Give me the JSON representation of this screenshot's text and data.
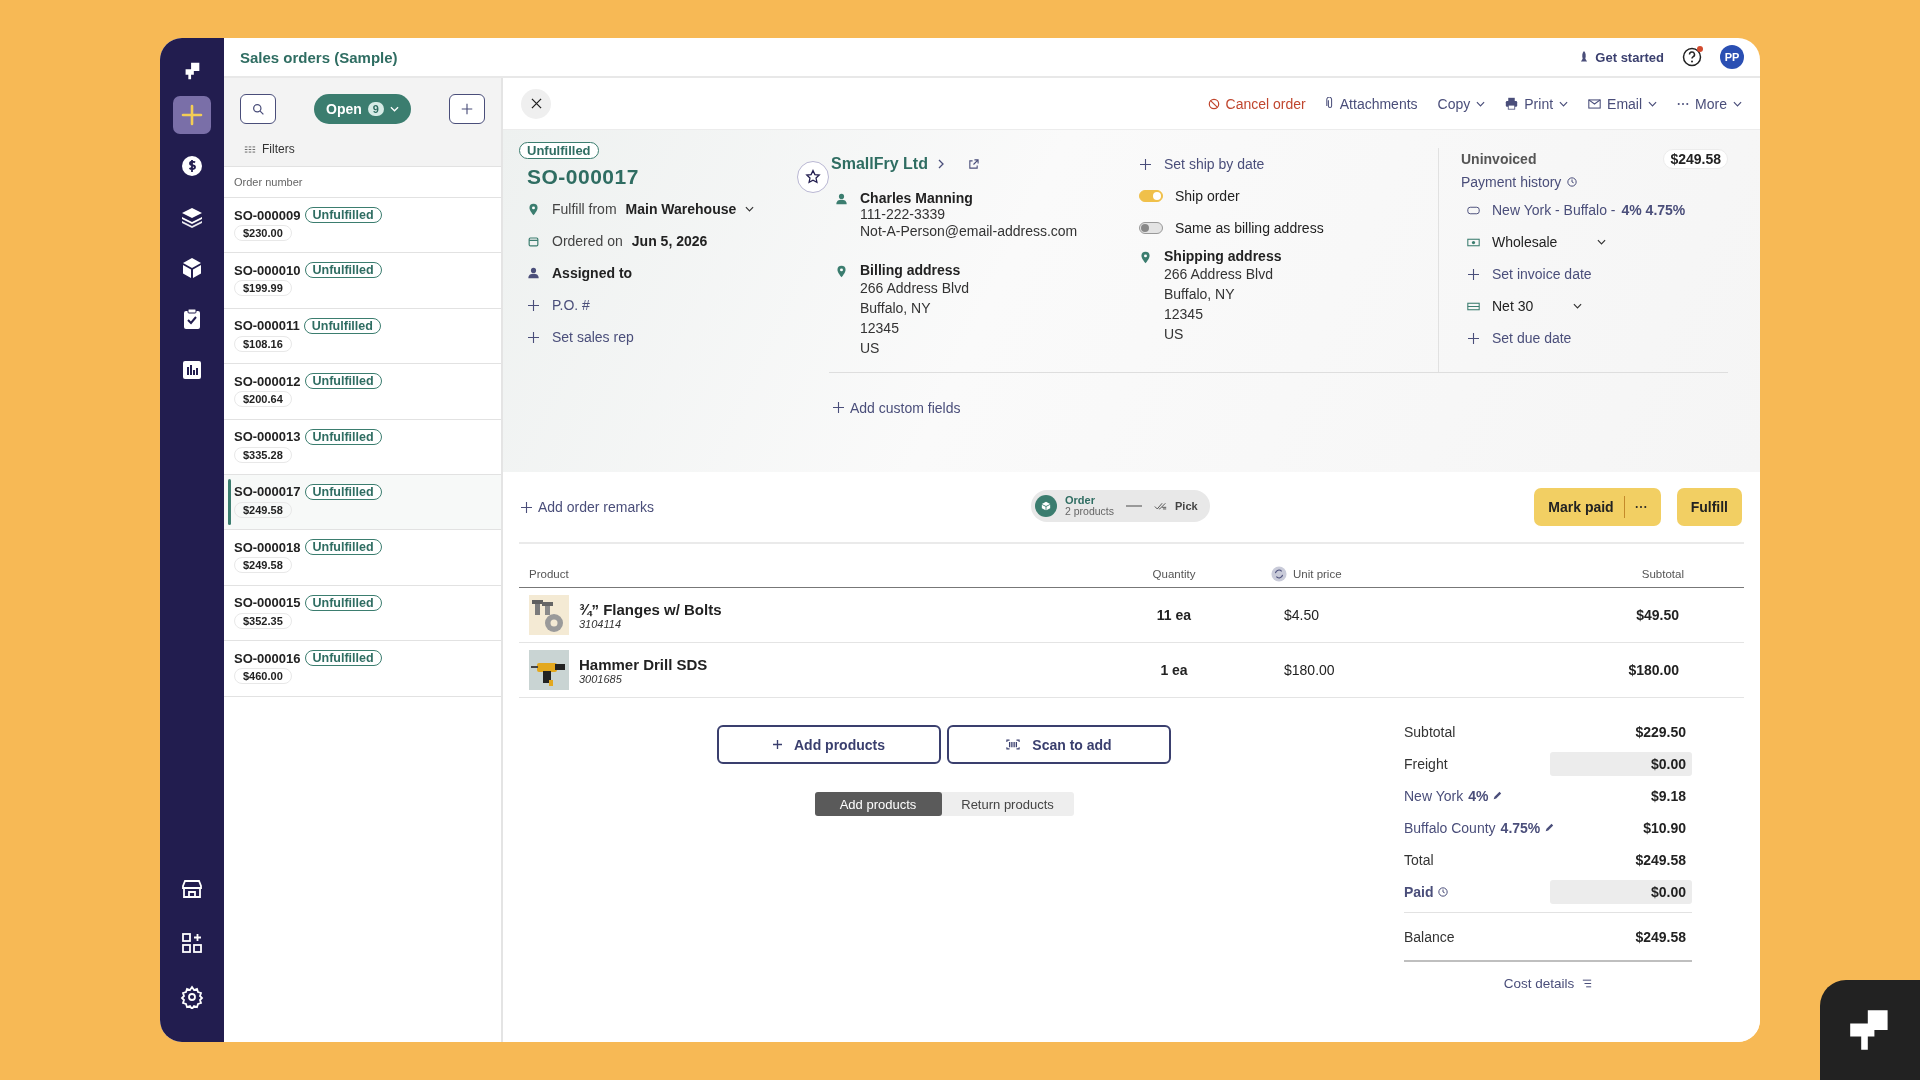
{
  "app_title": "Sales orders (Sample)",
  "header": {
    "get_started": "Get started",
    "avatar": "PP",
    "help_notification": true
  },
  "nav": {
    "items": [
      {
        "selected": true
      },
      {
        "selected": false
      },
      {
        "selected": false
      },
      {
        "selected": false
      },
      {
        "selected": false
      },
      {
        "selected": false
      }
    ],
    "bottom_items": [
      {
        "selected": false
      },
      {
        "selected": false
      },
      {
        "selected": false
      }
    ]
  },
  "list": {
    "filter": "Open",
    "count": "9",
    "filters": "Filters",
    "column": "Order number",
    "rows": [
      {
        "number": "SO-000009",
        "status": "Unfulfilled",
        "amount": "$230.00",
        "selected": false
      },
      {
        "number": "SO-000010",
        "status": "Unfulfilled",
        "amount": "$199.99",
        "selected": false
      },
      {
        "number": "SO-000011",
        "status": "Unfulfilled",
        "amount": "$108.16",
        "selected": false
      },
      {
        "number": "SO-000012",
        "status": "Unfulfilled",
        "amount": "$200.64",
        "selected": false
      },
      {
        "number": "SO-000013",
        "status": "Unfulfilled",
        "amount": "$335.28",
        "selected": false
      },
      {
        "number": "SO-000017",
        "status": "Unfulfilled",
        "amount": "$249.58",
        "selected": true
      },
      {
        "number": "SO-000018",
        "status": "Unfulfilled",
        "amount": "$249.58",
        "selected": false
      },
      {
        "number": "SO-000015",
        "status": "Unfulfilled",
        "amount": "$352.35",
        "selected": false
      },
      {
        "number": "SO-000016",
        "status": "Unfulfilled",
        "amount": "$460.00",
        "selected": false
      }
    ]
  },
  "toolbar": {
    "actions": [
      {
        "label": "Cancel order",
        "kind": "cancel",
        "dropdown": false
      },
      {
        "label": "Attachments",
        "kind": "attach",
        "dropdown": false
      },
      {
        "label": "Copy",
        "kind": "plain",
        "dropdown": true
      },
      {
        "label": "Print",
        "kind": "print",
        "dropdown": true
      },
      {
        "label": "Email",
        "kind": "email",
        "dropdown": true
      },
      {
        "label": "More",
        "kind": "more",
        "dropdown": true
      }
    ]
  },
  "order": {
    "status": "Unfulfilled",
    "number": "SO-000017",
    "starred": false,
    "fulfill_from": {
      "label": "Fulfill from",
      "value": "Main Warehouse"
    },
    "ordered_on": {
      "label": "Ordered on",
      "value": "Jun 5, 2026"
    },
    "assigned_to": "Assigned to",
    "po": "P.O. #",
    "sales_rep": "Set sales rep"
  },
  "customer": {
    "name": "SmallFry Ltd",
    "contact": "Charles Manning",
    "phone": "111-222-3339",
    "email": "Not-A-Person@email-address.com",
    "billing_title": "Billing address",
    "billing_lines": [
      "266 Address Blvd",
      "Buffalo, NY",
      "12345",
      "US"
    ]
  },
  "shipping": {
    "ship_by": "Set ship by date",
    "toggles": [
      {
        "label": "Ship order",
        "on": true
      },
      {
        "label": "Same as billing address",
        "on": false
      }
    ],
    "title": "Shipping address",
    "lines": [
      "266 Address Blvd",
      "Buffalo, NY",
      "12345",
      "US"
    ]
  },
  "invoice": {
    "status": "Uninvoiced",
    "amount": "$249.58",
    "payment_history": "Payment history",
    "tax": "New York - Buffalo - **4% 4.75%**",
    "price_list": "Wholesale",
    "invoice_date": "Set invoice date",
    "terms": "Net 30",
    "due_date": "Set due date"
  },
  "custom_fields": "Add custom fields",
  "remarks": "Add order remarks",
  "steps": [
    {
      "title": "Order",
      "subtitle": "2 products",
      "selected": true
    },
    {
      "title": "Pick",
      "selected": false
    }
  ],
  "actions": {
    "mark_paid": "Mark paid",
    "fulfill": "Fulfill"
  },
  "table": {
    "columns": [
      "Product",
      "Quantity",
      "Unit price",
      "Subtotal"
    ],
    "rows": [
      {
        "name": "¾” Flanges w/ Bolts",
        "sku": "3104114",
        "quantity": "11 ea",
        "unit_price": "$4.50",
        "subtotal": "$49.50",
        "kind": "picture"
      },
      {
        "name": "Hammer Drill SDS",
        "sku": "3001685",
        "quantity": "1 ea",
        "unit_price": "$180.00",
        "subtotal": "$180.00",
        "kind": "picture"
      }
    ]
  },
  "add_products": "Add products",
  "scan_to_add": "Scan to add",
  "modes": [
    {
      "label": "Add products",
      "selected": true
    },
    {
      "label": "Return products",
      "selected": false
    }
  ],
  "totals": [
    {
      "label": "Subtotal",
      "value": "$229.50",
      "kind": "plain"
    },
    {
      "label": "Freight",
      "value": "$0.00",
      "kind": "field"
    },
    {
      "label": "New York",
      "rate": "4%",
      "value": "$9.18",
      "kind": "tax"
    },
    {
      "label": "Buffalo County",
      "rate": "4.75%",
      "value": "$10.90",
      "kind": "tax"
    },
    {
      "label": "Total",
      "value": "$249.58",
      "kind": "plain"
    },
    {
      "label": "Paid",
      "value": "$0.00",
      "kind": "payment"
    }
  ],
  "balance": {
    "label": "Balance",
    "value": "$249.58"
  },
  "cost_details": "Cost details"
}
